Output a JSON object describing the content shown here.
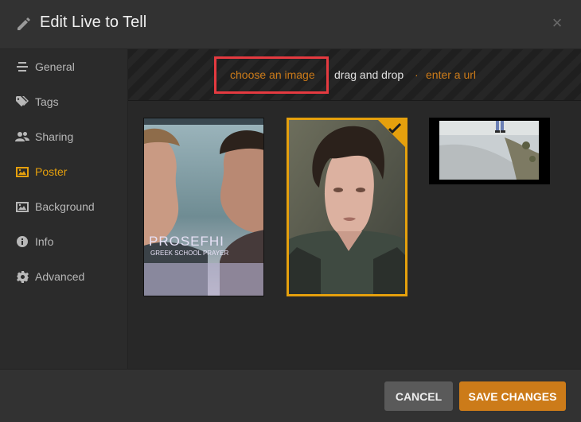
{
  "header": {
    "title": "Edit Live to Tell",
    "close_icon": "×"
  },
  "sidebar": {
    "items": [
      {
        "label": "General",
        "icon": "list-icon"
      },
      {
        "label": "Tags",
        "icon": "tag-icon"
      },
      {
        "label": "Sharing",
        "icon": "users-icon"
      },
      {
        "label": "Poster",
        "icon": "image-icon",
        "active": true
      },
      {
        "label": "Background",
        "icon": "image-icon"
      },
      {
        "label": "Info",
        "icon": "info-icon"
      },
      {
        "label": "Advanced",
        "icon": "gear-icon"
      }
    ]
  },
  "upload": {
    "choose_label": "choose an image",
    "dnd_label": "drag and drop",
    "separator": "·",
    "url_label": "enter a url"
  },
  "posters": [
    {
      "name": "poster-option-1",
      "title": "PROSEFHI",
      "subtitle": "GREEK SCHOOL PRAYER",
      "selected": false
    },
    {
      "name": "poster-option-2",
      "selected": true
    },
    {
      "name": "poster-option-3",
      "selected": false
    }
  ],
  "footer": {
    "cancel_label": "CANCEL",
    "save_label": "SAVE CHANGES"
  },
  "colors": {
    "accent": "#e5a00d",
    "link": "#cc7b19",
    "highlight": "#e53a40"
  }
}
